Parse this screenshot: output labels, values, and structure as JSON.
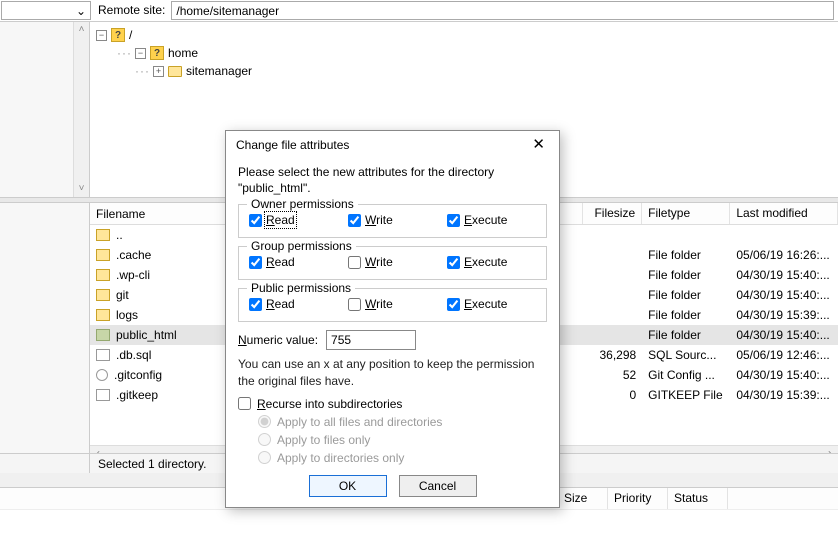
{
  "remote": {
    "label": "Remote site:",
    "path": "/home/sitemanager"
  },
  "tree": {
    "root": "/",
    "home": "home",
    "sitemanager": "sitemanager"
  },
  "columns": {
    "name": "Filename",
    "size": "Filesize",
    "type": "Filetype",
    "mod": "Last modified"
  },
  "files": [
    {
      "name": "..",
      "icon": "fi-folder",
      "size": "",
      "type": "",
      "mod": ""
    },
    {
      "name": ".cache",
      "icon": "fi-folder",
      "size": "",
      "type": "File folder",
      "mod": "05/06/19 16:26:..."
    },
    {
      "name": ".wp-cli",
      "icon": "fi-folder",
      "size": "",
      "type": "File folder",
      "mod": "04/30/19 15:40:..."
    },
    {
      "name": "git",
      "icon": "fi-folder",
      "size": "",
      "type": "File folder",
      "mod": "04/30/19 15:40:..."
    },
    {
      "name": "logs",
      "icon": "fi-folder",
      "size": "",
      "type": "File folder",
      "mod": "04/30/19 15:39:..."
    },
    {
      "name": "public_html",
      "icon": "fi-folder-g",
      "size": "",
      "type": "File folder",
      "mod": "04/30/19 15:40:...",
      "selected": true
    },
    {
      "name": ".db.sql",
      "icon": "fi-file",
      "size": "36,298",
      "type": "SQL Sourc...",
      "mod": "05/06/19 12:46:..."
    },
    {
      "name": ".gitconfig",
      "icon": "fi-gear",
      "size": "52",
      "type": "Git Config ...",
      "mod": "04/30/19 15:40:..."
    },
    {
      "name": ".gitkeep",
      "icon": "fi-file",
      "size": "0",
      "type": "GITKEEP File",
      "mod": "04/30/19 15:39:..."
    }
  ],
  "status": "Selected 1 directory.",
  "queue_cols": {
    "size": "Size",
    "priority": "Priority",
    "status": "Status"
  },
  "dialog": {
    "title": "Change file attributes",
    "intro": "Please select the new attributes for the directory \"public_html\".",
    "owner_legend": "Owner permissions",
    "group_legend": "Group permissions",
    "public_legend": "Public permissions",
    "read": "ead",
    "read_u": "R",
    "write": "rite",
    "write_u": "W",
    "execute": "xecute",
    "execute_u": "E",
    "numeric_label_u": "N",
    "numeric_label": "umeric value:",
    "numeric_value": "755",
    "hint": "You can use an x at any position to keep the permission the original files have.",
    "recurse_u": "R",
    "recurse": "ecurse into subdirectories",
    "radio1": "Apply to all files and directories",
    "radio2": "Apply to files only",
    "radio3": "Apply to directories only",
    "ok": "OK",
    "cancel": "Cancel",
    "owner": {
      "r": true,
      "w": true,
      "x": true
    },
    "group": {
      "r": true,
      "w": false,
      "x": true
    },
    "public": {
      "r": true,
      "w": false,
      "x": true
    }
  }
}
